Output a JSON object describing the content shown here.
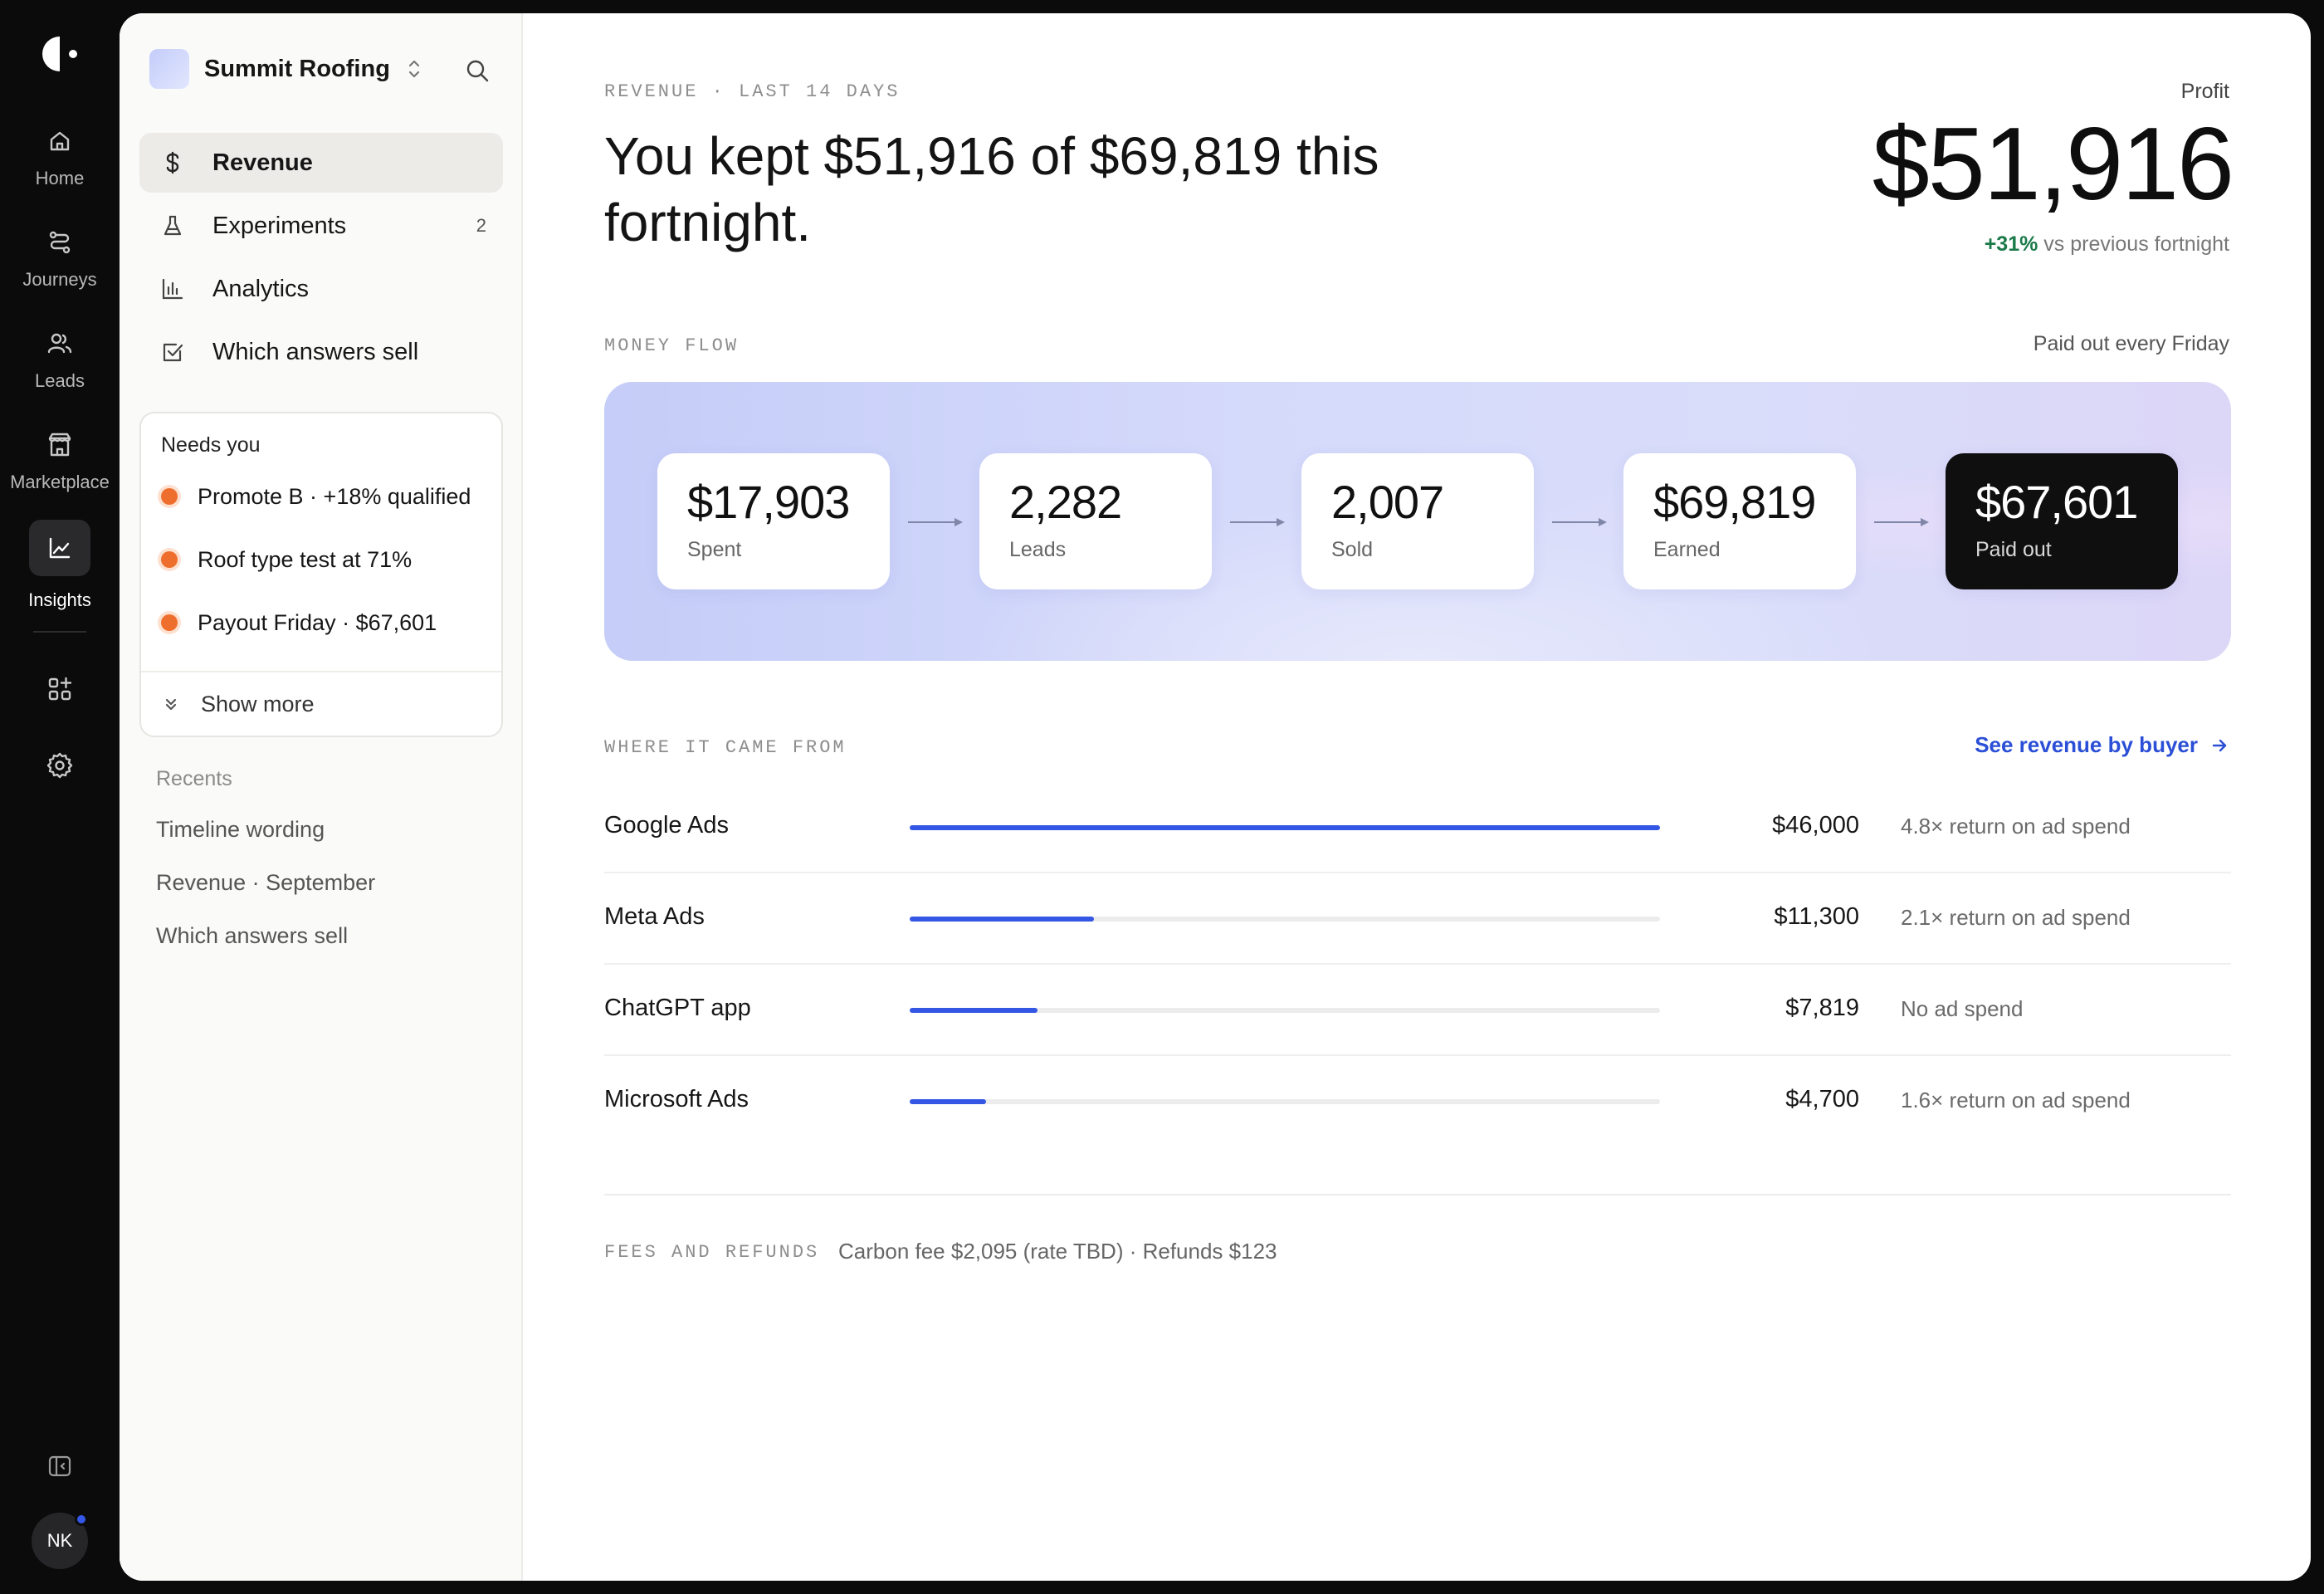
{
  "rail": {
    "items": [
      {
        "label": "Home",
        "icon": "home-icon"
      },
      {
        "label": "Journeys",
        "icon": "route-icon"
      },
      {
        "label": "Leads",
        "icon": "users-icon"
      },
      {
        "label": "Marketplace",
        "icon": "store-icon"
      },
      {
        "label": "Insights",
        "icon": "chart-line-icon",
        "active": true
      }
    ],
    "avatar_initials": "NK"
  },
  "sidebar": {
    "workspace": "Summit Roofing",
    "nav": [
      {
        "label": "Revenue",
        "icon": "dollar-icon",
        "active": true
      },
      {
        "label": "Experiments",
        "icon": "flask-icon",
        "badge": "2"
      },
      {
        "label": "Analytics",
        "icon": "bar-chart-icon"
      },
      {
        "label": "Which answers sell",
        "icon": "checkbox-icon"
      }
    ],
    "needs_you": {
      "title": "Needs you",
      "items": [
        "Promote B · +18% qualified",
        "Roof type test at 71%",
        "Payout Friday · $67,601"
      ],
      "show_more": "Show more"
    },
    "recents": {
      "title": "Recents",
      "items": [
        "Timeline wording",
        "Revenue · September",
        "Which answers sell"
      ]
    }
  },
  "main": {
    "kicker": "REVENUE · LAST 14 DAYS",
    "headline": "You kept $51,916 of $69,819 this fortnight.",
    "profit": {
      "label": "Profit",
      "value": "$51,916",
      "change": "+31%",
      "change_suffix": " vs previous fortnight",
      "change_color": "#1b7a4a"
    },
    "money_flow": {
      "title": "MONEY FLOW",
      "note": "Paid out every Friday",
      "cards": [
        {
          "value": "$17,903",
          "label": "Spent"
        },
        {
          "value": "2,282",
          "label": "Leads"
        },
        {
          "value": "2,007",
          "label": "Sold"
        },
        {
          "value": "$69,819",
          "label": "Earned"
        },
        {
          "value": "$67,601",
          "label": "Paid out",
          "dark": true
        }
      ]
    },
    "sources": {
      "title": "WHERE IT CAME FROM",
      "link": "See revenue by buyer",
      "accent": "#3456e4",
      "rows": [
        {
          "name": "Google Ads",
          "amount": "$46,000",
          "share": 1.0,
          "note": "4.8× return on ad spend"
        },
        {
          "name": "Meta Ads",
          "amount": "$11,300",
          "share": 0.2457,
          "note": "2.1× return on ad spend"
        },
        {
          "name": "ChatGPT app",
          "amount": "$7,819",
          "share": 0.17,
          "note": "No ad spend"
        },
        {
          "name": "Microsoft Ads",
          "amount": "$4,700",
          "share": 0.1022,
          "note": "1.6× return on ad spend"
        }
      ]
    },
    "fees": {
      "title": "FEES AND REFUNDS",
      "text": "Carbon fee $2,095 (rate TBD) · Refunds $123"
    }
  }
}
